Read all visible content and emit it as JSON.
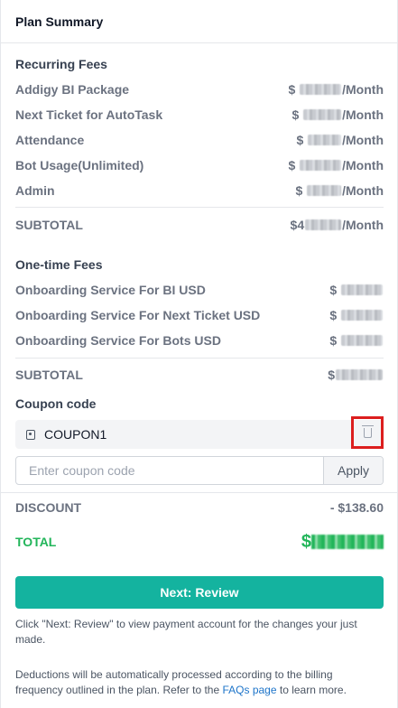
{
  "header": {
    "title": "Plan Summary"
  },
  "recurring": {
    "title": "Recurring Fees",
    "items": [
      {
        "label": "Addigy BI Package",
        "currency": "$",
        "unit": "/Month"
      },
      {
        "label": "Next Ticket for AutoTask",
        "currency": "$",
        "unit": "/Month"
      },
      {
        "label": "Attendance",
        "currency": "$",
        "unit": "/Month"
      },
      {
        "label": "Bot Usage(Unlimited)",
        "currency": "$",
        "unit": "/Month"
      },
      {
        "label": "Admin",
        "currency": "$",
        "unit": "/Month"
      }
    ],
    "subtotal_label": "SUBTOTAL",
    "subtotal_currency": "$4",
    "subtotal_unit": "/Month"
  },
  "onetime": {
    "title": "One-time Fees",
    "items": [
      {
        "label": "Onboarding Service For BI USD",
        "currency": "$"
      },
      {
        "label": "Onboarding Service For Next Ticket USD",
        "currency": "$"
      },
      {
        "label": "Onboarding Service For Bots USD",
        "currency": "$"
      }
    ],
    "subtotal_label": "SUBTOTAL",
    "subtotal_currency": "$"
  },
  "coupon": {
    "title": "Coupon code",
    "applied_code": "COUPON1",
    "input_placeholder": "Enter coupon code",
    "apply_label": "Apply"
  },
  "discount": {
    "label": "DISCOUNT",
    "value": "- $138.60"
  },
  "total": {
    "label": "TOTAL",
    "currency": "$"
  },
  "next_button": {
    "label": "Next: Review"
  },
  "notes": {
    "review_note": "Click \"Next: Review\" to view payment account for the changes your just made.",
    "deduction_note_pre": "Deductions will be automatically processed according to the billing frequency outlined in the plan. Refer to the ",
    "faq_link": "FAQs page",
    "deduction_note_post": " to learn more."
  },
  "colors": {
    "accent": "#14b39f",
    "total_green": "#22b55a",
    "highlight_red": "#dc1e1e",
    "link_blue": "#1d74c9"
  }
}
